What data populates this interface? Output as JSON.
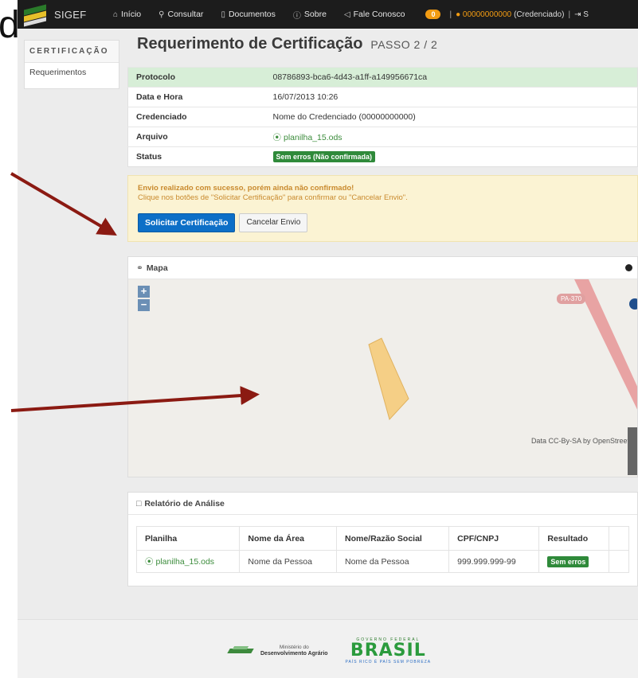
{
  "slide": {
    "letter": "d"
  },
  "navbar": {
    "brand": "SIGEF",
    "items": [
      {
        "icon": "home-icon",
        "glyph": "⌂",
        "label": "Início"
      },
      {
        "icon": "search-icon",
        "glyph": "⚲",
        "label": "Consultar"
      },
      {
        "icon": "document-icon",
        "glyph": "▯",
        "label": "Documentos"
      },
      {
        "icon": "info-icon",
        "glyph": "ⓘ",
        "label": "Sobre"
      },
      {
        "icon": "megaphone-icon",
        "glyph": "◁",
        "label": "Fale Conosco"
      }
    ],
    "notification_count": "0",
    "separator": "|",
    "user_id": "00000000000",
    "user_role": "(Credenciado)",
    "logout_label": "S"
  },
  "sidebar": {
    "heading": "CERTIFICAÇÃO",
    "items": [
      {
        "label": "Requerimentos"
      }
    ]
  },
  "page": {
    "title": "Requerimento de Certificação",
    "step": "PASSO 2 / 2"
  },
  "info": {
    "protocolo_label": "Protocolo",
    "protocolo_value": "08786893-bca6-4d43-a1ff-a149956671ca",
    "data_label": "Data e Hora",
    "data_value": "16/07/2013 10:26",
    "credenciado_label": "Credenciado",
    "credenciado_value": "Nome do Credenciado (00000000000)",
    "arquivo_label": "Arquivo",
    "arquivo_value": "planilha_15.ods",
    "status_label": "Status",
    "status_value": "Sem erros (Não confirmada)"
  },
  "alert": {
    "title": "Envio realizado com sucesso, porém ainda não confirmado!",
    "text": "Clique nos botões de \"Solicitar Certificação\" para confirmar ou \"Cancelar Envio\".",
    "primary_label": "Solicitar Certificação",
    "secondary_label": "Cancelar Envio"
  },
  "map": {
    "title": "Mapa",
    "zoom_in": "+",
    "zoom_out": "−",
    "road_label": "PA-370",
    "attribution": "Data CC-By-SA by OpenStreet"
  },
  "report": {
    "title": "Relatório de Análise",
    "columns": [
      "Planilha",
      "Nome da Área",
      "Nome/Razão Social",
      "CPF/CNPJ",
      "Resultado"
    ],
    "rows": [
      {
        "planilha": "planilha_15.ods",
        "area": "Nome da Pessoa",
        "razao": "Nome da Pessoa",
        "cpf": "999.999.999-99",
        "resultado": "Sem erros"
      }
    ]
  },
  "footer": {
    "mda_line1": "Ministério do",
    "mda_line2": "Desenvolvimento Agrário",
    "brasil_top": "GOVERNO FEDERAL",
    "brasil_word": "BRASIL",
    "brasil_sub": "PAÍS RICO É PAÍS SEM POBREZA"
  },
  "colors": {
    "navbar_bg": "#1c1c1c",
    "primary_blue": "#0d6fc7",
    "success_green": "#2f8a3a",
    "highlight_row": "#d7eed7",
    "alert_bg": "#fbf3d3",
    "arrow": "#8b1a12"
  }
}
